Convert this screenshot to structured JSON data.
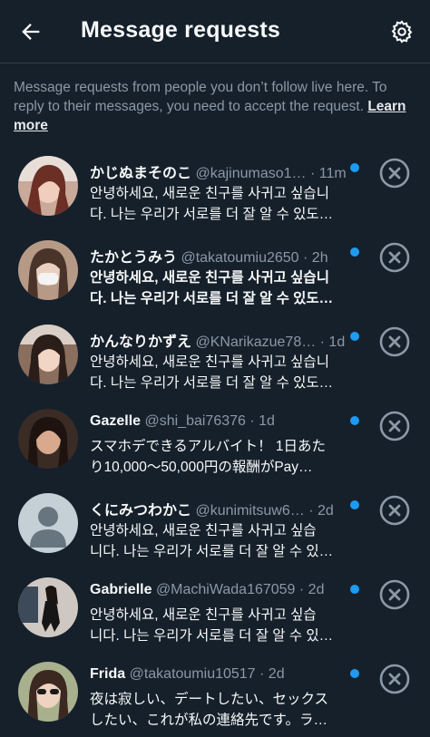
{
  "header": {
    "title": "Message requests"
  },
  "notice": {
    "text": "Message requests from people you don’t follow live here. To reply to their messages, you need to accept the request. ",
    "link": "Learn more"
  },
  "colors": {
    "background": "#15202b",
    "accent": "#1d9bf0",
    "secondary_text": "#8b98a5"
  },
  "requests": [
    {
      "name": "かじぬまそのこ",
      "handle_time": "@kajinumaso1… · 11m",
      "line1": "안녕하세요, 새로운 친구를 사귀고 싶습니",
      "line2": "다. 나는 우리가 서로를 더 잘 알 수 있도…",
      "unread": false
    },
    {
      "name": "たかとうみう",
      "handle_time": "@takatoumiu2650 · 2h",
      "line1": "안녕하세요, 새로운 친구를 사귀고 싶습니",
      "line2": "다. 나는 우리가 서로를 더 잘 알 수 있도…",
      "unread": true
    },
    {
      "name": "かんなりかずえ",
      "handle_time": "@KNarikazue78… · 1d",
      "line1": "안녕하세요, 새로운 친구를 사귀고 싶습니",
      "line2": "다. 나는 우리가 서로를 더 잘 알 수 있도…",
      "unread": false
    },
    {
      "name": "Gazelle",
      "handle_time": "@shi_bai76376 · 1d",
      "line1": "スマホデできるアルバイト！ 1日あた",
      "line2": "り10,000〜50,000円の報酬がPay…",
      "unread": false
    },
    {
      "name": "くにみつわかこ",
      "handle_time": "@kunimitsuw6… · 2d",
      "line1": "안녕하세요, 새로운 친구를 사귀고 싶습",
      "line2": "니다. 나는 우리가 서로를 더 잘 알 수 있…",
      "unread": false
    },
    {
      "name": "Gabrielle",
      "handle_time": "@MachiWada167059 · 2d",
      "line1": "안녕하세요, 새로운 친구를 사귀고 싶습",
      "line2": "니다. 나는 우리가 서로를 더 잘 알 수 있…",
      "unread": false
    },
    {
      "name": "Frida",
      "handle_time": "@takatoumiu10517 · 2d",
      "line1": "夜は寂しい、デートしたい、セックス",
      "line2": "したい、これが私の連絡先です。ラ…",
      "unread": false
    }
  ]
}
